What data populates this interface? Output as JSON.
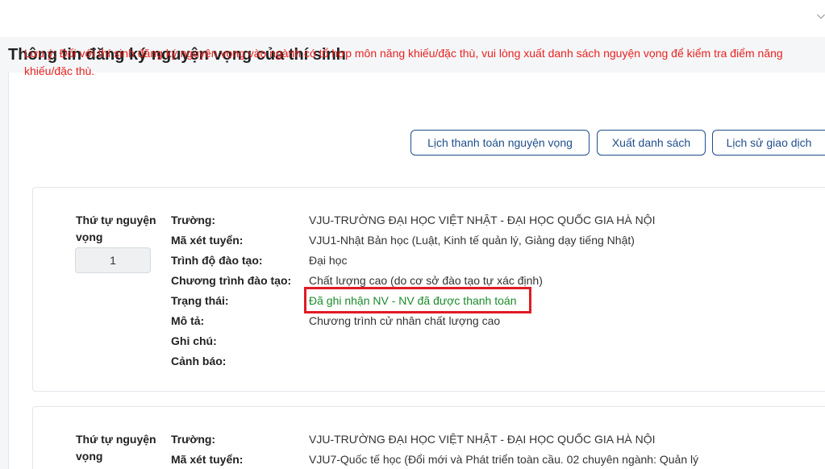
{
  "topbar": {
    "chevron_icon": "chevron-down-icon",
    "chevron_glyph": "⌵"
  },
  "page_title": "Thông tin đăng ký nguyện vọng của thí sinh",
  "note": "Lưu ý: Đối với thí sinh đăng ký nguyện vọng vào ngành có tổ hợp môn năng khiếu/đặc thù, vui lòng xuất danh sách nguyện vọng để kiểm tra điểm năng khiếu/đặc thù.",
  "buttons": {
    "payment_schedule": "Lịch thanh toán nguyện vọng",
    "export_list": "Xuất danh sách",
    "transaction_history": "Lịch sử giao dịch"
  },
  "colors": {
    "note_red": "#e8231f",
    "accent_blue": "#1f4e8c",
    "status_green": "#1a8a2a",
    "highlight_red": "#e01b24"
  },
  "labels": {
    "order": "Thứ tự nguyện vọng",
    "school": "Trường:",
    "admission_code": "Mã xét tuyển:",
    "level": "Trình độ đào tạo:",
    "program": "Chương trình đào tạo:",
    "status": "Trạng thái:",
    "description": "Mô tả:",
    "notes": "Ghi chú:",
    "warning": "Cảnh báo:"
  },
  "wishes": [
    {
      "order": "1",
      "school": "VJU-TRƯỜNG ĐẠI HỌC VIỆT NHẬT - ĐẠI HỌC QUỐC GIA HÀ NỘI",
      "admission_code": "VJU1-Nhật Bản học (Luật, Kinh tế quản lý, Giảng dạy tiếng Nhật)",
      "level": "Đại học",
      "program": "Chất lượng cao (do cơ sở đào tạo tự xác định)",
      "status": "Đã ghi nhận NV - NV đã được thanh toán",
      "description": "Chương trình cử nhân chất lượng cao",
      "notes": "",
      "warning": ""
    },
    {
      "school": "VJU-TRƯỜNG ĐẠI HỌC VIỆT NHẬT - ĐẠI HỌC QUỐC GIA HÀ NỘI",
      "admission_code": "VJU7-Quốc tế học (Đổi mới và Phát triển toàn cầu. 02 chuyên ngành: Quản lý"
    }
  ]
}
